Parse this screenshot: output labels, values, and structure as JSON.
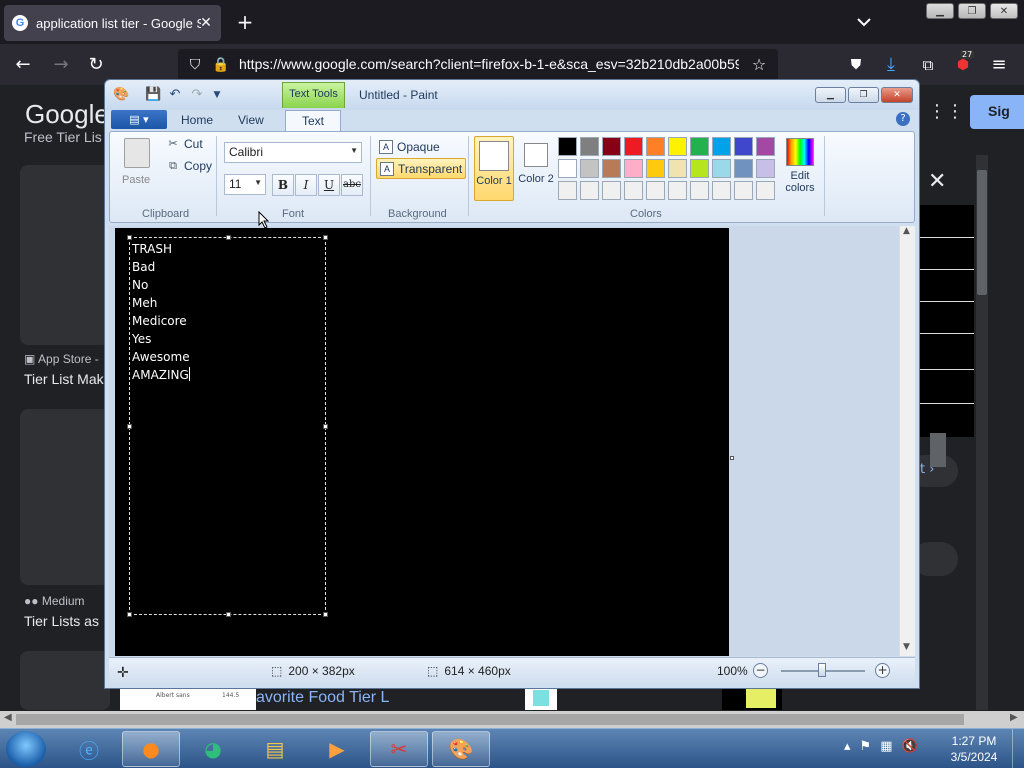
{
  "browser": {
    "tab_title": "application list tier - Google Sea",
    "url": "https://www.google.com/search?client=firefox-b-1-e&sca_esv=32b210db2a00b59",
    "extension_badge": "27"
  },
  "google": {
    "logo": "Google",
    "snippet_top": "Free Tier Lis",
    "result2_source": "App Store -",
    "result2_title": "Tier List Mak",
    "result3_source": "Medium",
    "result3_title": "Tier Lists as",
    "bottom_link": "avorite Food Tier L",
    "bottom_font": "Albert sans",
    "bottom_size": "144.5",
    "sign_in": "Sig",
    "next_label": "t"
  },
  "paint": {
    "title": "Untitled - Paint",
    "context_tab": "Text Tools",
    "tabs": {
      "home": "Home",
      "view": "View",
      "text": "Text"
    },
    "clipboard": {
      "paste": "Paste",
      "cut": "Cut",
      "copy": "Copy",
      "group": "Clipboard"
    },
    "font": {
      "family": "Calibri",
      "size": "11",
      "bold": "B",
      "italic": "I",
      "underline": "U",
      "strike": "abc",
      "group": "Font"
    },
    "background": {
      "opaque": "Opaque",
      "transparent": "Transparent",
      "group": "Background"
    },
    "colors": {
      "color1_label": "Color 1",
      "color2_label": "Color 2",
      "edit_label": "Edit colors",
      "group": "Colors",
      "palette": [
        "#000000",
        "#7f7f7f",
        "#880015",
        "#ed1c24",
        "#ff7f27",
        "#fff200",
        "#22b14c",
        "#00a2e8",
        "#3f48cc",
        "#a349a4",
        "#ffffff",
        "#c3c3c3",
        "#b97a57",
        "#ffaec9",
        "#ffc90e",
        "#efe4b0",
        "#b5e61d",
        "#99d9ea",
        "#7092be",
        "#c8bfe7",
        "#f0f0f0",
        "#f0f0f0",
        "#f0f0f0",
        "#f0f0f0",
        "#f0f0f0",
        "#f0f0f0",
        "#f0f0f0",
        "#f0f0f0",
        "#f0f0f0",
        "#f0f0f0"
      ]
    },
    "text_lines": [
      "TRASH",
      "Bad",
      "No",
      "Meh",
      "Medicore",
      "Yes",
      "Awesome",
      "AMAZING"
    ],
    "status": {
      "selection_size": "200 × 382px",
      "canvas_size": "614 × 460px",
      "zoom": "100%"
    }
  },
  "taskbar": {
    "time": "1:27 PM",
    "date": "3/5/2024"
  }
}
